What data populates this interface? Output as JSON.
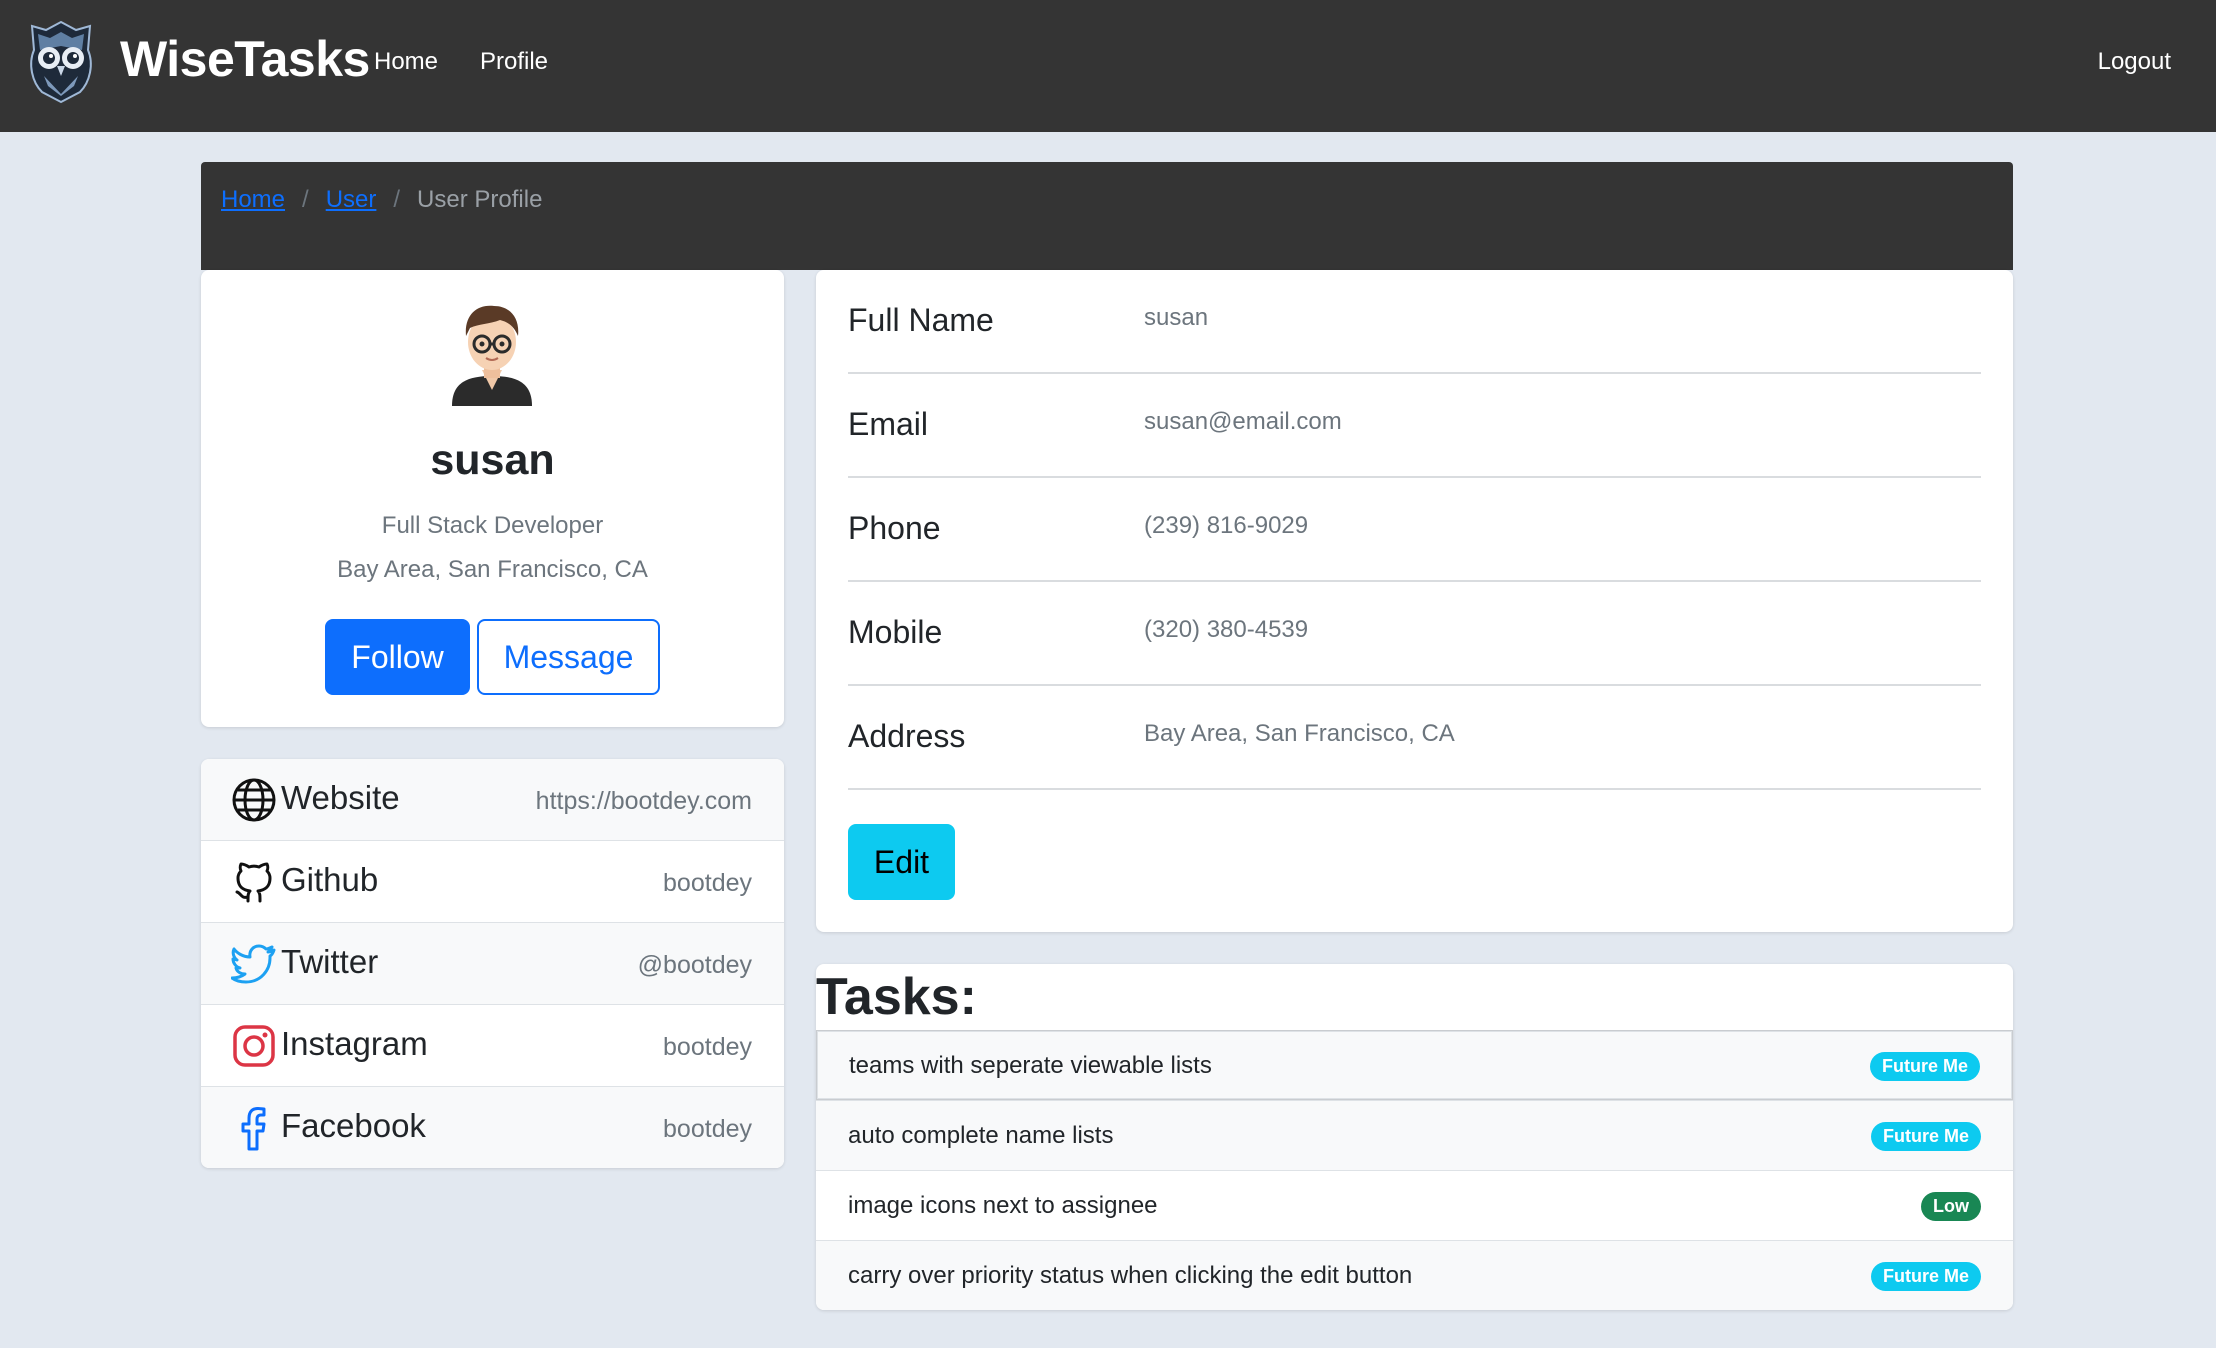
{
  "navbar": {
    "brand": "WiseTasks",
    "links": {
      "home": "Home",
      "profile": "Profile",
      "logout": "Logout"
    }
  },
  "breadcrumb": {
    "home": "Home",
    "user": "User",
    "current": "User Profile",
    "separator": "/"
  },
  "profile": {
    "name": "susan",
    "title": "Full Stack Developer",
    "location": "Bay Area, San Francisco, CA",
    "follow_label": "Follow",
    "message_label": "Message"
  },
  "social": [
    {
      "label": "Website",
      "value": "https://bootdey.com",
      "icon": "globe-icon"
    },
    {
      "label": "Github",
      "value": "bootdey",
      "icon": "github-icon"
    },
    {
      "label": "Twitter",
      "value": "@bootdey",
      "icon": "twitter-icon"
    },
    {
      "label": "Instagram",
      "value": "bootdey",
      "icon": "instagram-icon"
    },
    {
      "label": "Facebook",
      "value": "bootdey",
      "icon": "facebook-icon"
    }
  ],
  "info": {
    "full_name": {
      "label": "Full Name",
      "value": "susan"
    },
    "email": {
      "label": "Email",
      "value": "susan@email.com"
    },
    "phone": {
      "label": "Phone",
      "value": "(239) 816-9029"
    },
    "mobile": {
      "label": "Mobile",
      "value": "(320) 380-4539"
    },
    "address": {
      "label": "Address",
      "value": "Bay Area, San Francisco, CA"
    },
    "edit_label": "Edit"
  },
  "tasks": {
    "title": "Tasks:",
    "items": [
      {
        "text": "teams with seperate viewable lists",
        "badge": "Future Me"
      },
      {
        "text": "auto complete name lists",
        "badge": "Future Me"
      },
      {
        "text": "image icons next to assignee",
        "badge": "Low"
      },
      {
        "text": "carry over priority status when clicking the edit button",
        "badge": "Future Me"
      }
    ]
  },
  "colors": {
    "navbar": "#343434",
    "primary": "#0d6efd",
    "info": "#0dcaf0",
    "success": "#198754",
    "background": "#e2e8f0"
  }
}
